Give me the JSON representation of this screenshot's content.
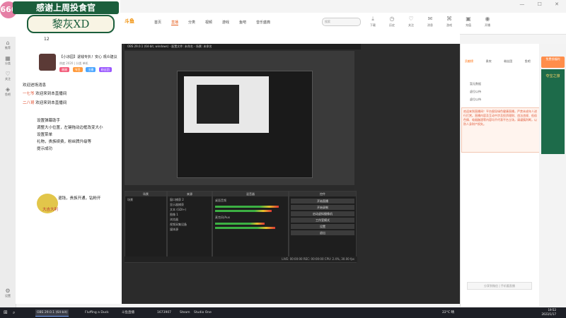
{
  "banner": {
    "badge": "666",
    "title": "感谢上周投食官",
    "name": "黎灰XD"
  },
  "browser": {
    "window_controls": "— ☐ ✕"
  },
  "topnav": {
    "logo": "斗鱼",
    "items": [
      "首页",
      "直播",
      "分类",
      "视频",
      "游戏",
      "鱼吧",
      "音乐盛典"
    ],
    "active_index": 1,
    "search_placeholder": "搜索",
    "icons": [
      {
        "label": "下载",
        "icon": "download-icon"
      },
      {
        "label": "历史",
        "icon": "history-icon"
      },
      {
        "label": "关注",
        "icon": "heart-icon"
      },
      {
        "label": "消息",
        "icon": "message-icon"
      },
      {
        "label": "游戏",
        "icon": "gamepad-icon"
      },
      {
        "label": "充值",
        "icon": "wallet-icon"
      },
      {
        "label": "开播",
        "icon": "camera-icon"
      }
    ]
  },
  "sidebar": {
    "items": [
      {
        "label": "推荐",
        "icon": "home-icon"
      },
      {
        "label": "分类",
        "icon": "grid-icon"
      },
      {
        "label": "关注",
        "icon": "heart-icon"
      },
      {
        "label": "鱼吧",
        "icon": "fish-icon"
      },
      {
        "label": "设置",
        "icon": "gear-icon"
      }
    ]
  },
  "room": {
    "count": "12",
    "title": "【小凉园】退钱专扒！安心 观众建议",
    "stats": "热度 2020 | 分类 单机",
    "tags": [
      "谢谢",
      "节目",
      "主播",
      "粉丝团"
    ],
    "tag_colors": [
      "#f25c7a",
      "#ff9a3c",
      "#4aa6ff",
      "#9b59ff"
    ],
    "follow_label": "关注",
    "level_badge": "等级勋章"
  },
  "chat": {
    "lines": [
      {
        "text": "欢迎进场消息"
      },
      {
        "level": "一七爷",
        "text": "欢迎来到本直播间"
      },
      {
        "level": "二八哥",
        "text": "欢迎来到本直播间"
      },
      {
        "text": "设置弹幕助手"
      },
      {
        "text": "调整大小位置，左键拖动边框改变大小"
      },
      {
        "text": "设置菜单"
      },
      {
        "text": "礼物，贵族续费，粉丝牌升级等"
      },
      {
        "text": "提示成功"
      },
      {
        "text": "退钱，贵族开通，钻粉开"
      },
      {
        "text": "大吉大利"
      }
    ]
  },
  "obs": {
    "title": "OBS 29.0.1 (64-bit, windows) - 配置文件: 未命名 - 场景: 未命名",
    "docks": [
      {
        "name": "场景",
        "items": [
          "场景"
        ]
      },
      {
        "name": "来源",
        "items": [
          "窗口捕获 2",
          "显示器捕获",
          "文本 (GDI+)",
          "图像 1",
          "浏览器",
          "视频采集设备",
          "媒体源"
        ]
      },
      {
        "name": "混音器",
        "items": [
          "桌面音频",
          "麦克风/Aux"
        ]
      },
      {
        "name": "控件",
        "items": [
          "开始直播",
          "开始录制",
          "启动虚拟摄像机",
          "工作室模式",
          "设置",
          "退出"
        ]
      }
    ],
    "status": "LIVE: 00:00:00   REC: 00:00:00   CPU: 2.4%, 30.00 fps"
  },
  "right_panel": {
    "tabs": [
      "贡献榜",
      "贵宾",
      "粉丝团",
      "鱼吧"
    ],
    "active_tab": 0,
    "items": [
      "暂无数据",
      "虚位以待",
      "虚位以待"
    ],
    "notice": "欢迎来到直播间！平台倡导绿色健康直播，严禁未成年人进行打赏。直播内容及互动中涉及投资理财、违法违规、低俗色情、吸烟酗酒等内容均不代表平台立场，请谨慎判断，以防人身财产损失。",
    "footer": "分享到微信 | 手机看直播",
    "ad_top": "免费领福利",
    "ad_card": "夺宝之旅"
  },
  "taskbar": {
    "items": [
      {
        "label": "OBS 29.0.1 (64-bit)",
        "active": true
      },
      {
        "label": "Fluffing a Duck",
        "active": false
      },
      {
        "label": "斗鱼直播",
        "active": false
      },
      {
        "label": "1673907",
        "active": false
      },
      {
        "label": "Steam",
        "active": false
      },
      {
        "label": "Studio One",
        "active": false
      }
    ],
    "weather": "22°C 晴",
    "time": "19:52",
    "date": "2023/1/17"
  }
}
